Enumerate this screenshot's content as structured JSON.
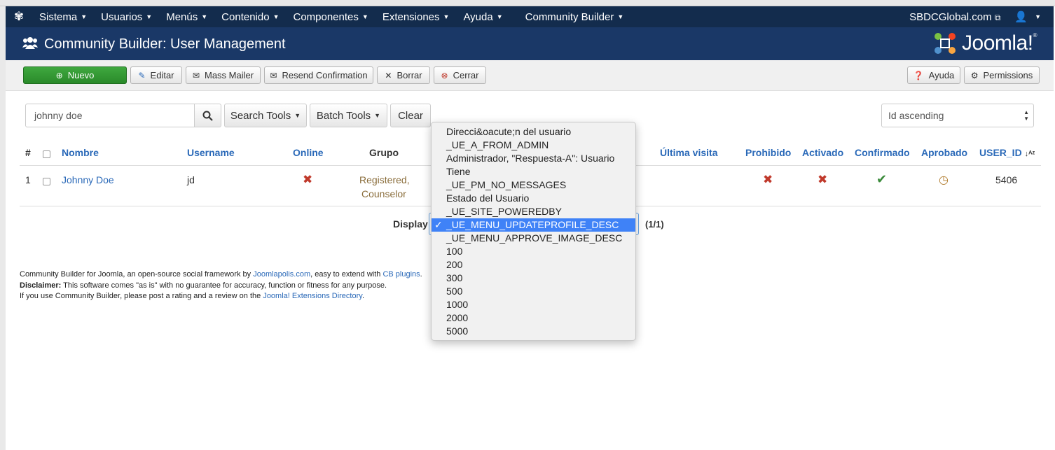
{
  "navbar": {
    "menus": [
      "Sistema",
      "Usuarios",
      "Menús",
      "Contenido",
      "Componentes",
      "Extensiones",
      "Ayuda"
    ],
    "community_builder": "Community Builder",
    "site_link": "SBDCGlobal.com"
  },
  "header": {
    "title": "Community Builder: User Management",
    "logo_text": "Joomla!"
  },
  "toolbar": {
    "new": "Nuevo",
    "edit": "Editar",
    "mass_mailer": "Mass Mailer",
    "resend": "Resend Confirmation",
    "delete": "Borrar",
    "close": "Cerrar",
    "help": "Ayuda",
    "permissions": "Permissions"
  },
  "filters": {
    "search_value": "johnny doe",
    "search_tools": "Search Tools",
    "batch_tools": "Batch Tools",
    "clear": "Clear",
    "sort": "Id ascending"
  },
  "table": {
    "headers": {
      "num": "#",
      "name": "Nombre",
      "username": "Username",
      "online": "Online",
      "group": "Grupo",
      "last_visit": "Última visita",
      "banned": "Prohibido",
      "activated": "Activado",
      "confirmed": "Confirmado",
      "approved": "Aprobado",
      "user_id": "USER_ID"
    },
    "rows": [
      {
        "num": "1",
        "name": "Johnny Doe",
        "username": "jd",
        "group_line1": "Registered,",
        "group_line2": "Counselor",
        "user_id": "5406"
      }
    ]
  },
  "pagination": {
    "display_label": "Display",
    "pages": "(1/1)"
  },
  "footer": {
    "line1_a": "Community Builder for Joomla, an open-source social framework by ",
    "line1_link1": "Joomlapolis.com",
    "line1_b": ", easy to extend with ",
    "line1_link2": "CB plugins",
    "line1_c": ".",
    "line2_bold": "Disclaimer:",
    "line2_rest": " This software comes \"as is\" with no guarantee for accuracy, function or fitness for any purpose.",
    "line3_a": "If you use Community Builder, please post a rating and a review on the ",
    "line3_link": "Joomla! Extensions Directory",
    "line3_b": "."
  },
  "dropdown": {
    "options": [
      "Direcci&oacute;n del usuario",
      "_UE_A_FROM_ADMIN",
      "Administrador, \"Respuesta-A\": Usuario",
      "Tiene",
      "_UE_PM_NO_MESSAGES",
      "Estado del Usuario",
      "_UE_SITE_POWEREDBY",
      "_UE_MENU_UPDATEPROFILE_DESC",
      "_UE_MENU_APPROVE_IMAGE_DESC",
      "100",
      "200",
      "300",
      "500",
      "1000",
      "2000",
      "5000"
    ],
    "selected_index": 7
  }
}
